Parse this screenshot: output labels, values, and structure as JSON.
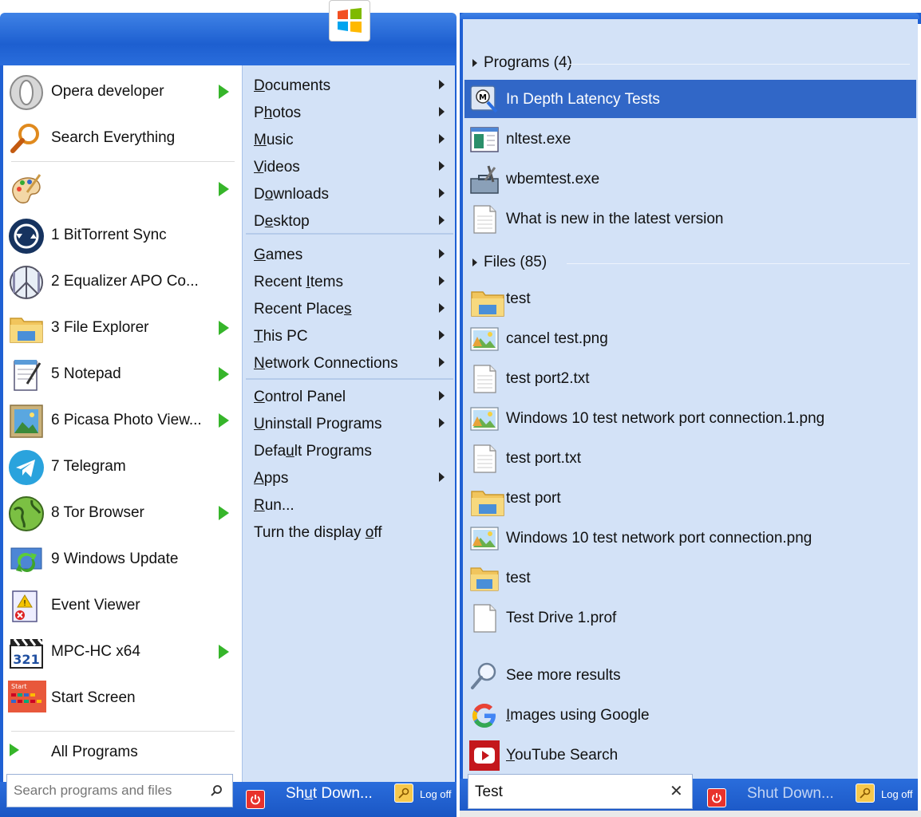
{
  "colors": {
    "accent": "#1f60d3",
    "selection": "#3167c7",
    "pane": "#d3e2f7",
    "arrow": "#36b52a"
  },
  "programs": [
    {
      "label": "Opera developer",
      "icon": "opera-icon",
      "arrow": true
    },
    {
      "label": "Search Everything",
      "icon": "magnifier-icon",
      "arrow": false
    },
    {
      "label": "",
      "icon": "paint-palette-icon",
      "arrow": true
    },
    {
      "label": "1 BitTorrent Sync",
      "icon": "bittorrent-sync-icon",
      "arrow": false
    },
    {
      "label": "2 Equalizer APO Co...",
      "icon": "equalizer-icon",
      "arrow": false
    },
    {
      "label": "3 File Explorer",
      "icon": "folder-icon",
      "arrow": true
    },
    {
      "label": "5 Notepad",
      "icon": "notepad-icon",
      "arrow": true
    },
    {
      "label": "6 Picasa Photo View...",
      "icon": "photo-icon",
      "arrow": true
    },
    {
      "label": "7 Telegram",
      "icon": "telegram-icon",
      "arrow": false
    },
    {
      "label": "8 Tor Browser",
      "icon": "globe-icon",
      "arrow": true
    },
    {
      "label": "9 Windows Update",
      "icon": "windows-update-icon",
      "arrow": false
    },
    {
      "label": "Event Viewer",
      "icon": "event-viewer-icon",
      "arrow": false
    },
    {
      "label": "MPC-HC x64",
      "icon": "clapboard-icon",
      "arrow": true
    },
    {
      "label": "Start Screen",
      "icon": "start-screen-icon",
      "arrow": false
    }
  ],
  "all_programs": "All Programs",
  "search_left": {
    "placeholder": "Search programs and files"
  },
  "places": [
    {
      "pre": "",
      "u": "D",
      "post": "ocuments",
      "arrow": true
    },
    {
      "pre": "P",
      "u": "h",
      "post": "otos",
      "arrow": true
    },
    {
      "pre": "",
      "u": "M",
      "post": "usic",
      "arrow": true
    },
    {
      "pre": "",
      "u": "V",
      "post": "ideos",
      "arrow": true
    },
    {
      "pre": "D",
      "u": "o",
      "post": "wnloads",
      "arrow": true
    },
    {
      "pre": "D",
      "u": "e",
      "post": "sktop",
      "arrow": true
    },
    {
      "pre": "",
      "u": "G",
      "post": "ames",
      "arrow": true
    },
    {
      "pre": "Recent ",
      "u": "I",
      "post": "tems",
      "arrow": true
    },
    {
      "pre": "Recent Place",
      "u": "s",
      "post": "",
      "arrow": true
    },
    {
      "pre": "",
      "u": "T",
      "post": "his PC",
      "arrow": true
    },
    {
      "pre": "",
      "u": "N",
      "post": "etwork Connections",
      "arrow": true
    },
    {
      "pre": "",
      "u": "C",
      "post": "ontrol Panel",
      "arrow": true
    },
    {
      "pre": "",
      "u": "U",
      "post": "ninstall Programs",
      "arrow": true
    },
    {
      "pre": "Defa",
      "u": "u",
      "post": "lt Programs",
      "arrow": false
    },
    {
      "pre": "",
      "u": "A",
      "post": "pps",
      "arrow": true
    },
    {
      "pre": "",
      "u": "R",
      "post": "un...",
      "arrow": false
    },
    {
      "pre": "Turn the display ",
      "u": "o",
      "post": "ff",
      "arrow": false
    }
  ],
  "footer_left": {
    "shutdown_pre": "Sh",
    "shutdown_u": "u",
    "shutdown_post": "t Down...",
    "logoff": "Log off"
  },
  "results": {
    "programs_header": "Programs (4)",
    "programs": [
      {
        "label": "In Depth Latency Tests",
        "icon": "latency-tool-icon",
        "selected": true
      },
      {
        "label": "nltest.exe",
        "icon": "exe-window-icon"
      },
      {
        "label": "wbemtest.exe",
        "icon": "toolbox-icon"
      },
      {
        "label": "What is new in the latest version",
        "icon": "text-file-icon"
      }
    ],
    "files_header": "Files (85)",
    "files": [
      {
        "label": "test",
        "icon": "folder-icon"
      },
      {
        "label": "cancel test.png",
        "icon": "image-file-icon"
      },
      {
        "label": "test port2.txt",
        "icon": "text-file-icon"
      },
      {
        "label": "Windows 10 test network port connection.1.png",
        "icon": "image-file-icon"
      },
      {
        "label": "test port.txt",
        "icon": "text-file-icon"
      },
      {
        "label": "test port",
        "icon": "folder-icon"
      },
      {
        "label": "Windows 10 test network port connection.png",
        "icon": "image-file-icon"
      },
      {
        "label": "test",
        "icon": "explorer-folder-icon"
      },
      {
        "label": "Test Drive 1.prof",
        "icon": "blank-file-icon"
      }
    ],
    "extra": [
      {
        "pre": "",
        "u": "",
        "post": "See more results",
        "icon": "search-icon"
      },
      {
        "pre": "",
        "u": "I",
        "post": "mages using Google",
        "icon": "google-icon"
      },
      {
        "pre": "",
        "u": "Y",
        "post": "ouTube Search",
        "icon": "youtube-icon"
      }
    ]
  },
  "search_right": {
    "value": "Test",
    "clear": "✕"
  },
  "footer_right": {
    "shutdown": "Shut Down...",
    "logoff": "Log off"
  }
}
